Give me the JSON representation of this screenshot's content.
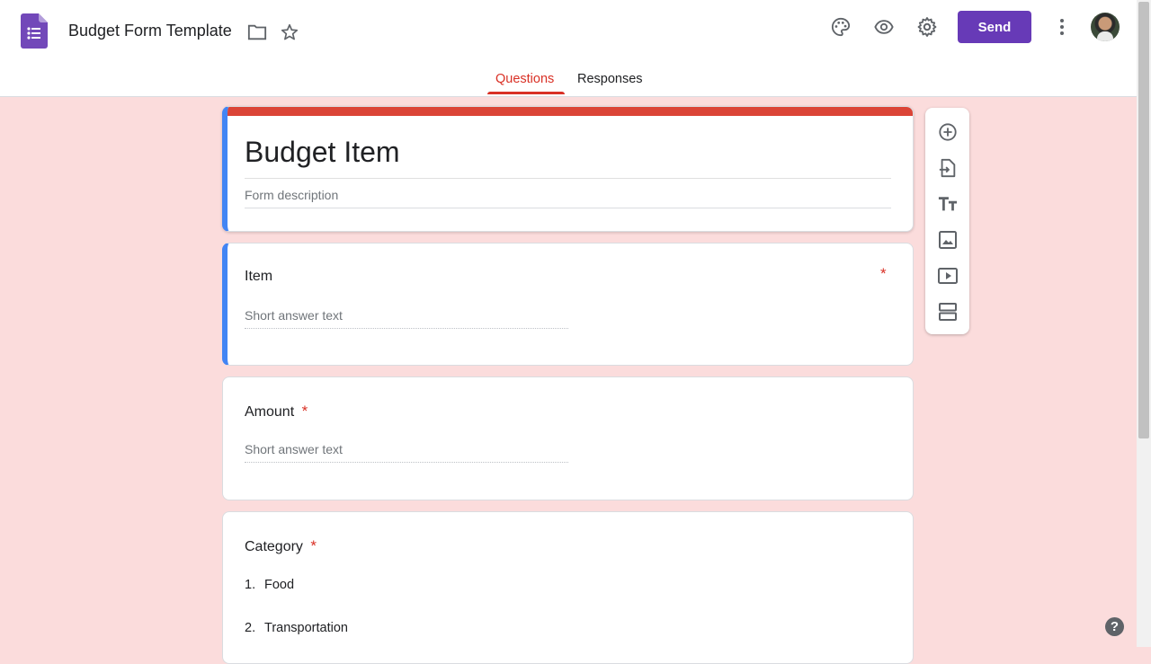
{
  "header": {
    "doc_title": "Budget Form Template",
    "send_label": "Send",
    "icons": [
      "forms-logo-icon",
      "folder-icon",
      "star-icon",
      "palette-icon",
      "eye-icon",
      "gear-icon",
      "more-vert-icon"
    ]
  },
  "tabs": [
    {
      "label": "Questions",
      "active": true
    },
    {
      "label": "Responses",
      "active": false
    }
  ],
  "form": {
    "title": "Budget Item",
    "description_placeholder": "Form description"
  },
  "questions": [
    {
      "title": "Item",
      "required_mark": "*",
      "answer_placeholder": "Short answer text"
    },
    {
      "title": "Amount",
      "required_mark": "*",
      "answer_placeholder": "Short answer text"
    },
    {
      "title": "Category",
      "required_mark": "*",
      "options": [
        {
          "num": "1.",
          "label": "Food"
        },
        {
          "num": "2.",
          "label": "Transportation"
        }
      ]
    }
  ],
  "toolbar": [
    "add-question-icon",
    "import-questions-icon",
    "add-title-icon",
    "add-image-icon",
    "add-video-icon",
    "add-section-icon"
  ],
  "help_label": "?",
  "colors": {
    "accent": "#673ab7",
    "active_tab": "#d93025",
    "title_bar": "#db4437",
    "active_card": "#4285f4",
    "background": "#fbdcdc"
  }
}
